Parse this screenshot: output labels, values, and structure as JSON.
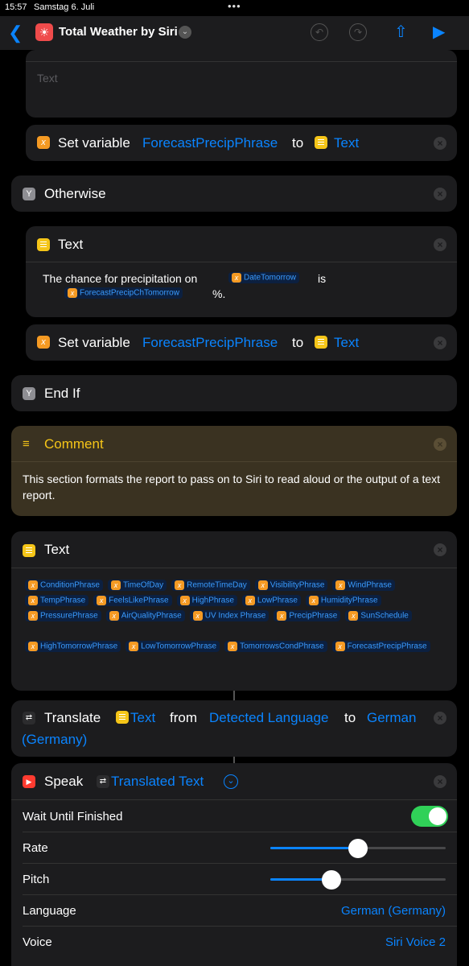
{
  "status": {
    "time": "15:57",
    "date": "Samstag 6. Juli",
    "dots": "•••"
  },
  "nav": {
    "title": "Total Weather by Siri"
  },
  "top_text": {
    "placeholder": "Text"
  },
  "set1": {
    "label": "Set variable",
    "var": "ForecastPrecipPhrase",
    "to": "to",
    "value": "Text"
  },
  "otherwise": {
    "label": "Otherwise"
  },
  "text2": {
    "title": "Text",
    "line1": "The chance for precipitation on",
    "var1": "DateTomorrow",
    "is": "is",
    "var2": "ForecastPrecipChTomorrow",
    "pct": "%."
  },
  "set2": {
    "label": "Set variable",
    "var": "ForecastPrecipPhrase",
    "to": "to",
    "value": "Text"
  },
  "endif": {
    "label": "End If"
  },
  "comment": {
    "title": "Comment",
    "body": "This section formats the report to pass on to Siri to read aloud or the output of a text report."
  },
  "text3": {
    "title": "Text",
    "rows": [
      [
        "ConditionPhrase",
        "TimeOfDay",
        "RemoteTimeDay",
        "VisibilityPhrase",
        "WindPhrase"
      ],
      [
        "TempPhrase",
        "FeelsLikePhrase",
        "HighPhrase",
        "LowPhrase",
        "HumidityPhrase"
      ],
      [
        "PressurePhrase",
        "AirQualityPhrase",
        "UV Index Phrase",
        "PrecipPhrase",
        "SunSchedule"
      ],
      [
        "HighTomorrowPhrase",
        "LowTomorrowPhrase",
        "TomorrowsCondPhrase",
        "ForecastPrecipPhrase"
      ]
    ]
  },
  "translate": {
    "label": "Translate",
    "input": "Text",
    "from": "from",
    "source": "Detected Language",
    "to": "to",
    "target_a": "German",
    "target_b": "(Germany)"
  },
  "speak": {
    "label": "Speak",
    "input": "Translated Text",
    "wait_label": "Wait Until Finished",
    "wait_on": true,
    "rate_label": "Rate",
    "rate_value": 0.5,
    "pitch_label": "Pitch",
    "pitch_value": 0.35,
    "language_label": "Language",
    "language_value": "German (Germany)",
    "voice_label": "Voice",
    "voice_value": "Siri Voice 2"
  }
}
